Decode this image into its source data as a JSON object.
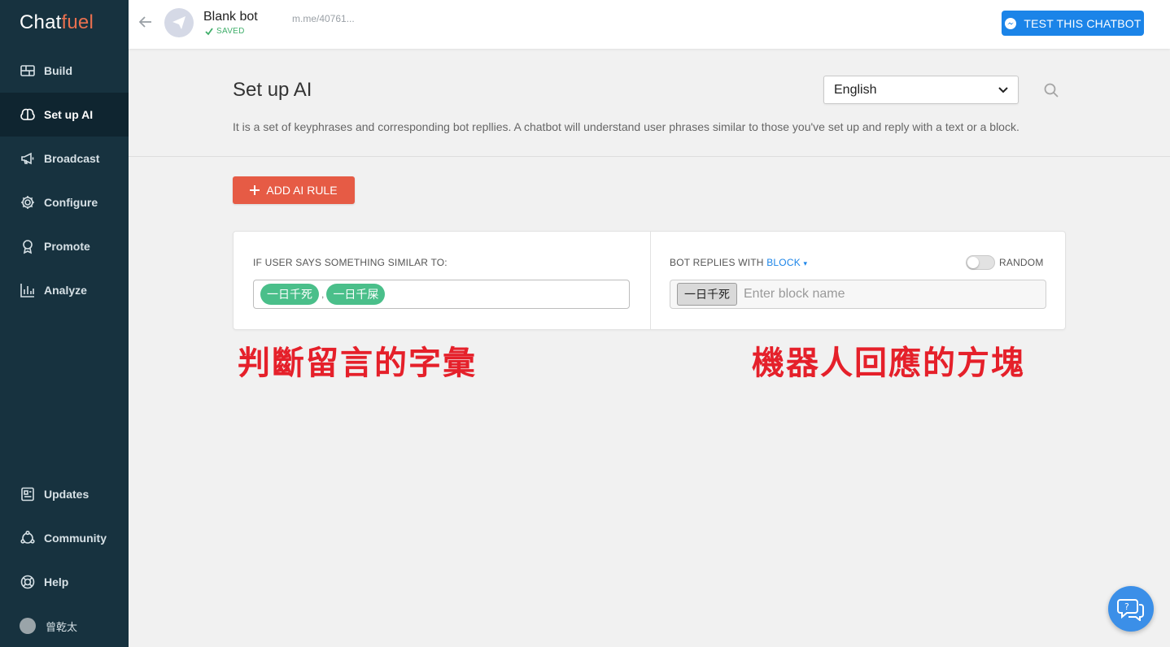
{
  "app": {
    "logo_part1": "Chat",
    "logo_part2": "fuel"
  },
  "sidebar": {
    "items": [
      {
        "label": "Build",
        "icon": "bricks-icon"
      },
      {
        "label": "Set up AI",
        "icon": "brain-icon",
        "active": true
      },
      {
        "label": "Broadcast",
        "icon": "megaphone-icon"
      },
      {
        "label": "Configure",
        "icon": "gear-icon"
      },
      {
        "label": "Promote",
        "icon": "badge-icon"
      },
      {
        "label": "Analyze",
        "icon": "bar-chart-icon"
      }
    ],
    "bottom_items": [
      {
        "label": "Updates",
        "icon": "news-icon"
      },
      {
        "label": "Community",
        "icon": "community-icon"
      },
      {
        "label": "Help",
        "icon": "lifebuoy-icon"
      },
      {
        "label": "曾乾太",
        "icon": "avatar"
      }
    ]
  },
  "header": {
    "bot_name": "Blank bot",
    "saved_status": "SAVED",
    "bot_link": "m.me/40761...",
    "test_button": "TEST THIS CHATBOT"
  },
  "page": {
    "title": "Set up AI",
    "language": "English",
    "description": "It is a set of keyphrases and corresponding bot repllies. A chatbot will understand user phrases similar to those you've set up and reply with a text or a block.",
    "add_rule_button": "ADD AI RULE"
  },
  "rule": {
    "user_says_label": "IF USER SAYS SOMETHING SIMILAR TO:",
    "phrases": [
      "一日千死",
      "一日千屎"
    ],
    "phrase_separator": ",",
    "bot_replies_label": "BOT REPLIES WITH",
    "reply_type": "BLOCK",
    "reply_type_caret": "▾",
    "random_label": "RANDOM",
    "random_enabled": false,
    "blocks": [
      "一日千死"
    ],
    "block_placeholder": "Enter block name"
  },
  "annotations": {
    "left": "判斷留言的字彙",
    "right": "機器人回應的方塊"
  },
  "colors": {
    "sidebar_bg": "#17323f",
    "accent_blue": "#1b84e8",
    "add_button": "#e65b45",
    "tag_green": "#4abf8a",
    "annotation_red": "#e5202a"
  }
}
